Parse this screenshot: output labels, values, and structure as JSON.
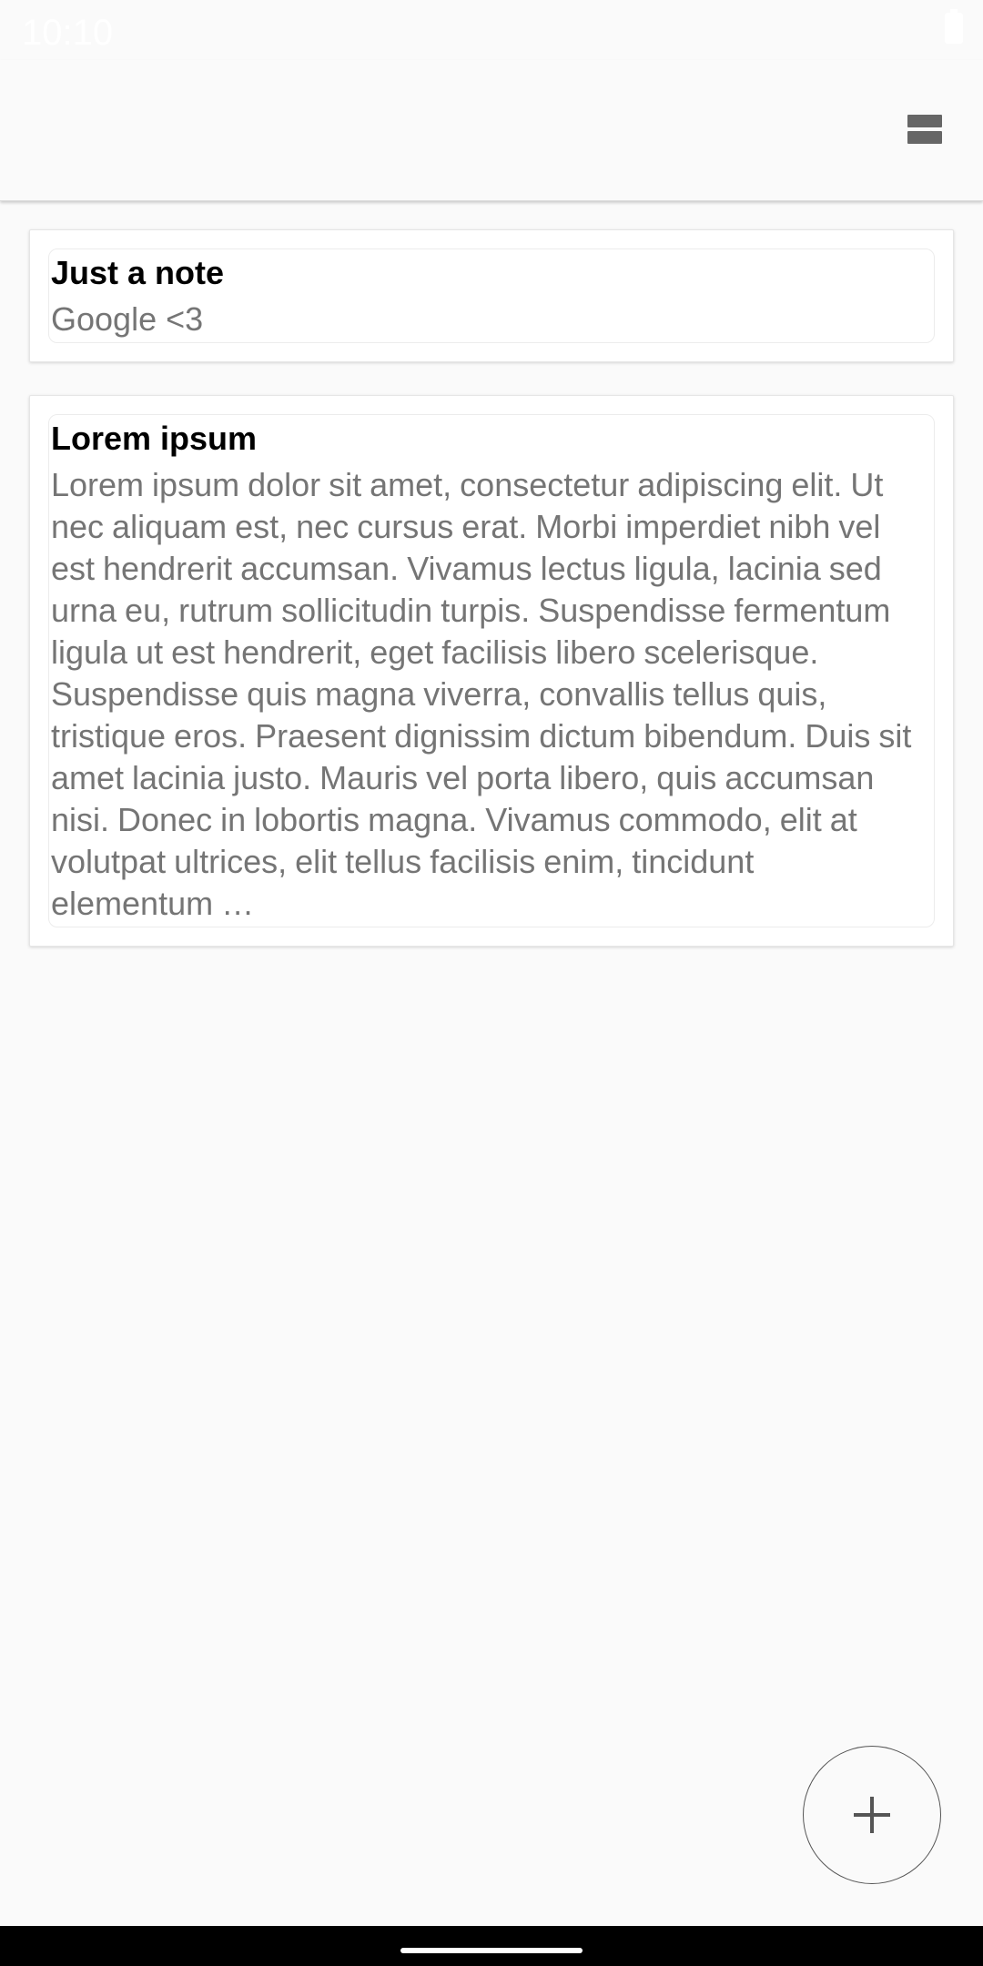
{
  "status_bar": {
    "time": "10:10"
  },
  "app_bar": {
    "view_toggle_icon": "view-agenda-icon"
  },
  "notes": [
    {
      "title": "Just a note",
      "body": "Google <3"
    },
    {
      "title": "Lorem ipsum",
      "body": "Lorem ipsum dolor sit amet, consectetur adipiscing elit. Ut nec aliquam est, nec cursus erat. Morbi imperdiet nibh vel est hendrerit accumsan. Vivamus lectus ligula, lacinia sed urna eu, rutrum sollicitudin turpis. Suspendisse fermentum ligula ut est hendrerit, eget facilisis libero scelerisque. Suspendisse quis magna viverra, convallis tellus quis, tristique eros. Praesent dignissim dictum bibendum. Duis sit amet lacinia justo. Mauris vel porta libero, quis accumsan nisi. Donec in lobortis magna. Vivamus commodo, elit at volutpat ultrices, elit tellus facilisis enim, tincidunt elementum …"
    }
  ],
  "fab": {
    "icon": "plus-icon"
  }
}
